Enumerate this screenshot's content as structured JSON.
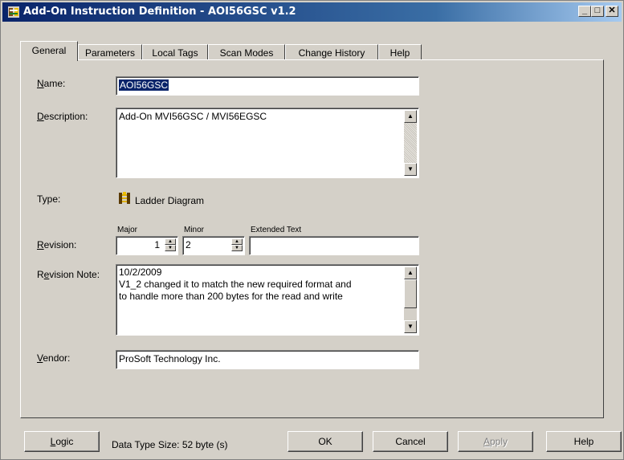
{
  "window": {
    "title": "Add-On Instruction Definition - AOI56GSC v1.2",
    "minimize": "_",
    "restore": "□",
    "close": "✕"
  },
  "tabs": [
    {
      "label": "General",
      "active": true
    },
    {
      "label": "Parameters"
    },
    {
      "label": "Local Tags"
    },
    {
      "label": "Scan Modes"
    },
    {
      "label": "Change History"
    },
    {
      "label": "Help"
    }
  ],
  "form": {
    "name_label_prefix": "N",
    "name_label_rest": "ame:",
    "name_value": "AOI56GSC",
    "description_label_prefix": "D",
    "description_label_rest": "escription:",
    "description_value": "Add-On MVI56GSC / MVI56EGSC",
    "type_label": "Type:",
    "type_value": "Ladder Diagram",
    "major_label": "Major",
    "minor_label": "Minor",
    "extended_text_label": "Extended Text",
    "revision_label_prefix": "R",
    "revision_label_rest": "evision:",
    "major_value": "1",
    "minor_value": "2",
    "extended_text_value": "",
    "revision_note_label_pre": "R",
    "revision_note_label_u": "e",
    "revision_note_label_rest": "vision Note:",
    "revision_note_lines": [
      "10/2/2009",
      "V1_2 changed it to match the new required format and",
      "to handle more than 200 bytes for the read and write"
    ],
    "vendor_label_prefix": "V",
    "vendor_label_rest": "endor:",
    "vendor_value": "ProSoft Technology Inc."
  },
  "footer": {
    "logic_prefix": "L",
    "logic_rest": "ogic",
    "data_type_size": "Data Type Size: 52 byte (s)",
    "ok": "OK",
    "cancel": "Cancel",
    "apply_prefix": "A",
    "apply_rest": "pply",
    "help": "Help"
  }
}
